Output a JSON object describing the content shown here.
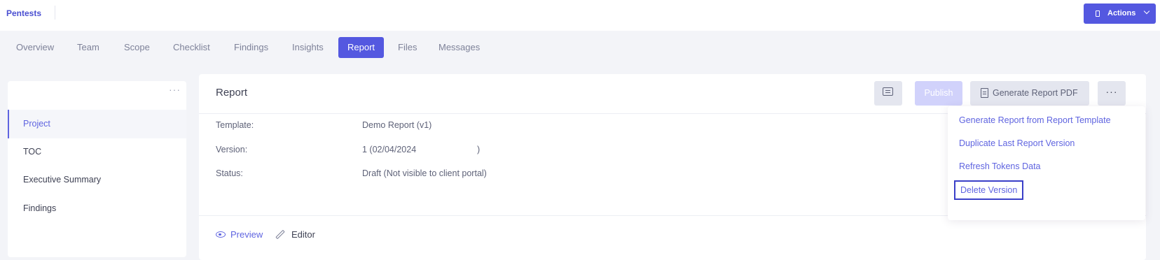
{
  "header": {
    "brand": "Pentests",
    "actions_label": "Actions"
  },
  "tabs": [
    "Overview",
    "Team",
    "Scope",
    "Checklist",
    "Findings",
    "Insights",
    "Report",
    "Files",
    "Messages"
  ],
  "active_tab": "Report",
  "sidebar": {
    "more_label": "···",
    "items": [
      "Project",
      "TOC",
      "Executive Summary",
      "Findings"
    ],
    "active_item": "Project"
  },
  "report": {
    "title": "Report",
    "publish_label": "Publish",
    "generate_pdf_label": "Generate Report PDF",
    "more_label": "···",
    "fields": [
      {
        "label": "Template:",
        "value": "Demo Report (v1)"
      },
      {
        "label": "Version:",
        "value": "1 (02/04/2024                         )"
      },
      {
        "label": "Status:",
        "value": "Draft (Not visible to client portal)"
      }
    ],
    "view_tabs": {
      "preview": "Preview",
      "editor": "Editor"
    }
  },
  "dropdown": {
    "items": [
      "Generate Report from Report Template",
      "Duplicate Last Report Version",
      "Refresh Tokens Data",
      "Delete Version"
    ],
    "focused_item": "Delete Version"
  },
  "colors": {
    "accent": "#5458e0",
    "link": "#5f64e0",
    "publish_disabled": "#d1d2fb",
    "background": "#f3f4f8"
  }
}
